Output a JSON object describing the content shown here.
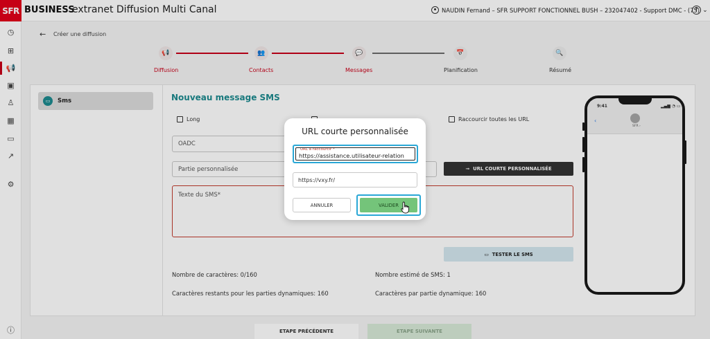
{
  "header": {
    "logo": "SFR",
    "brand": "BUSINESS",
    "title": "extranet Diffusion Multi Canal",
    "user": "NAUDIN Fernand – SFR SUPPORT FONCTIONNEL BUSH – 232047402 - Support DMC - (75)",
    "help": "?"
  },
  "sidebar": {
    "icons": [
      "clock-icon",
      "layout-icon",
      "megaphone-icon",
      "contacts-icon",
      "stamp-icon",
      "calendar-icon",
      "chat-icon",
      "chart-icon",
      "settings-icon",
      "info-icon"
    ]
  },
  "breadcrumb": {
    "back": "←",
    "label": "Créer une diffusion"
  },
  "stepper": {
    "steps": [
      {
        "label": "Diffusion",
        "icon": "📢"
      },
      {
        "label": "Contacts",
        "icon": "👥"
      },
      {
        "label": "Messages",
        "icon": "💬"
      },
      {
        "label": "Planification",
        "icon": "📅"
      },
      {
        "label": "Résumé",
        "icon": "🔍"
      }
    ]
  },
  "left": {
    "tab": "Sms"
  },
  "form": {
    "title": "Nouveau message SMS",
    "cb_long": "Long",
    "cb_shorten": "Raccourcir toutes les URL",
    "oadc": "OADC",
    "custom_part": "Partie personnalisée",
    "custom_url_btn": "URL COURTE PERSONNALISÉE",
    "sms_text": "Texte du SMS*",
    "test_btn": "TESTER LE SMS",
    "chars": "Nombre de caractères: 0/160",
    "est_sms": "Nombre estimé de SMS: 1",
    "remaining": "Caractères restants pour les parties dynamiques: 160",
    "per_part": "Caractères par partie dynamique: 160"
  },
  "phone": {
    "time": "9:41",
    "status": "▂▄▆ ◔ ▭",
    "sender": "SFR ›",
    "back": "‹"
  },
  "footer": {
    "prev": "ETAPE PRÉCÉDENTE",
    "next": "ETAPE SUIVANTE"
  },
  "modal": {
    "title": "URL courte personnalisée",
    "url_label": "URL à raccourcir *",
    "url_value": "https://assistance.utilisateur-relation",
    "short_value": "https://vxy.fr/",
    "cancel": "ANNULER",
    "ok": "VALIDER"
  },
  "colors": {
    "brand": "#e2001a",
    "teal": "#1d8a8f",
    "focus": "#29a7d6",
    "ok": "#74c47a"
  }
}
